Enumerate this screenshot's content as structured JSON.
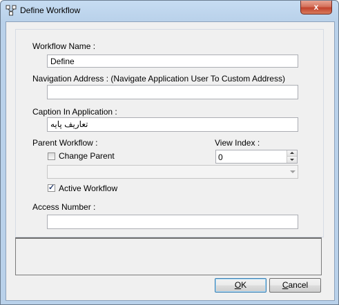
{
  "window": {
    "title": "Define Workflow",
    "close_label": "x"
  },
  "form": {
    "workflow_name_label": "Workflow Name :",
    "workflow_name_value": "Define",
    "navigation_label": "Navigation Address : (Navigate Application User To Custom Address)",
    "navigation_value": "",
    "caption_label": "Caption In Application :",
    "caption_value": "تعاريف پايه",
    "parent_workflow_label": "Parent Workflow :",
    "change_parent_label": "Change Parent",
    "change_parent_checked": false,
    "parent_combo_value": "",
    "view_index_label": "View Index :",
    "view_index_value": "0",
    "active_workflow_label": "Active Workflow",
    "active_workflow_checked": true,
    "access_number_label": "Access Number :",
    "access_number_value": ""
  },
  "buttons": {
    "ok_mnemonic": "O",
    "ok_rest": "K",
    "cancel_mnemonic": "C",
    "cancel_rest": "ancel"
  }
}
